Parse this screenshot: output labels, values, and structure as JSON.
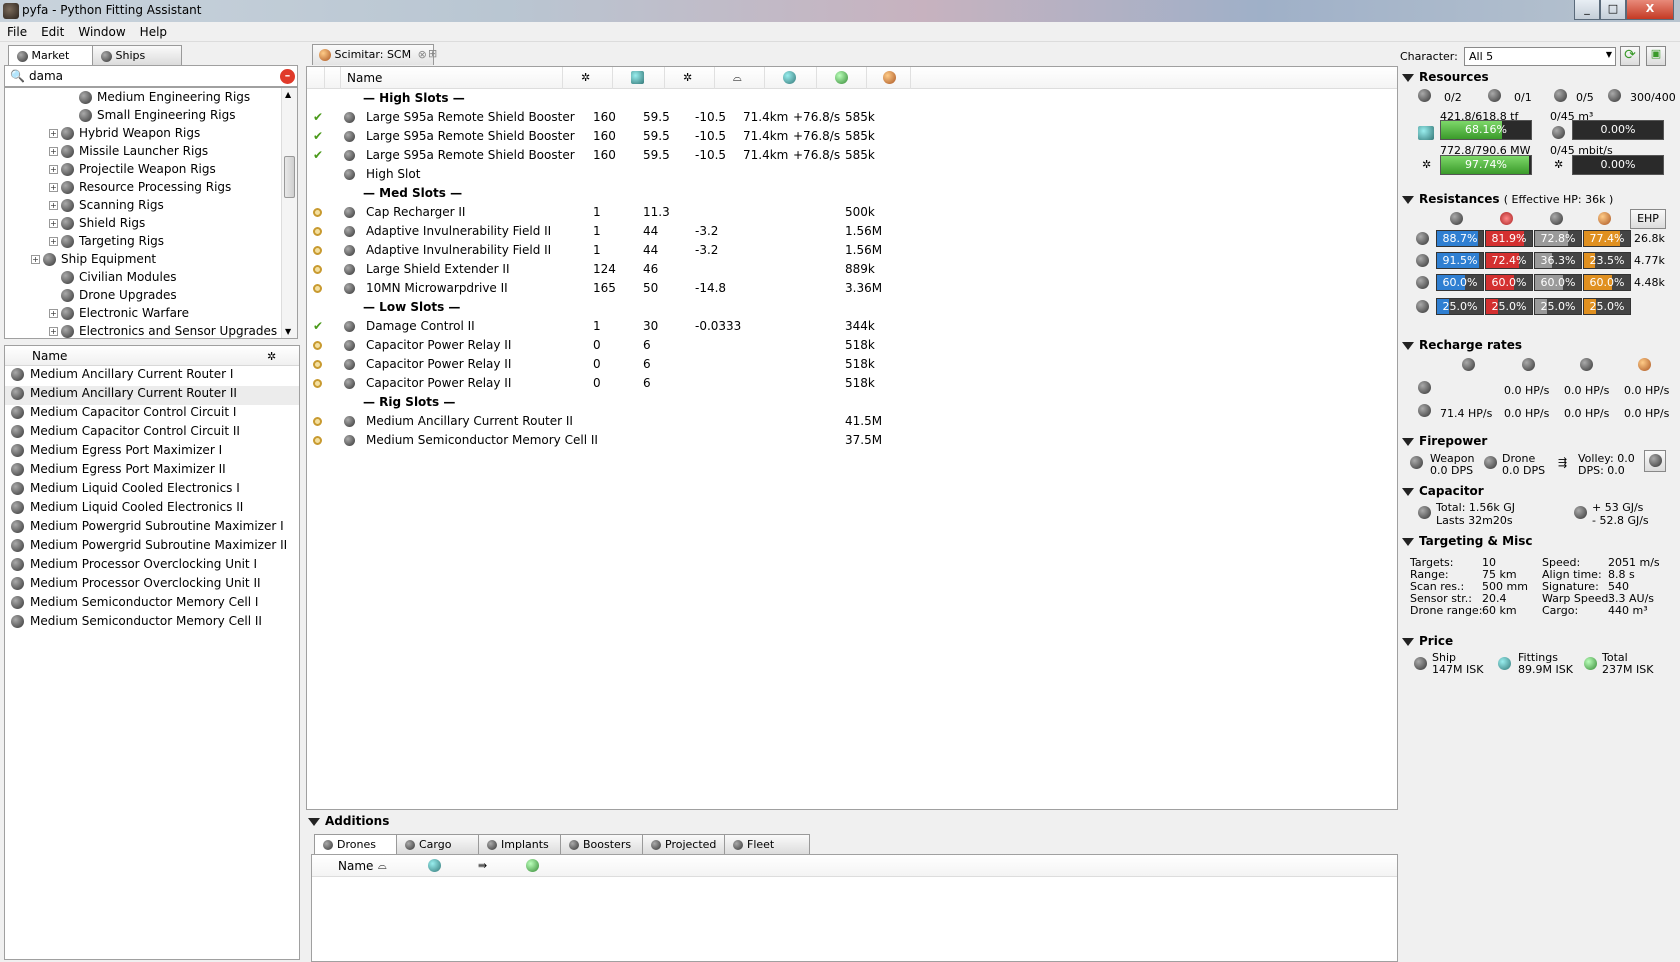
{
  "window": {
    "title": "pyfa - Python Fitting Assistant",
    "min": "_",
    "max": "□",
    "close": "X"
  },
  "menu": [
    "File",
    "Edit",
    "Window",
    "Help"
  ],
  "left": {
    "tabs": [
      "Market",
      "Ships"
    ],
    "search_value": "dama",
    "tree": [
      {
        "label": "Medium Engineering Rigs",
        "indent": 3,
        "exp": false
      },
      {
        "label": "Small Engineering Rigs",
        "indent": 3,
        "exp": false
      },
      {
        "label": "Hybrid Weapon Rigs",
        "indent": 2,
        "exp": true
      },
      {
        "label": "Missile Launcher Rigs",
        "indent": 2,
        "exp": true
      },
      {
        "label": "Projectile Weapon Rigs",
        "indent": 2,
        "exp": true
      },
      {
        "label": "Resource Processing Rigs",
        "indent": 2,
        "exp": true
      },
      {
        "label": "Scanning Rigs",
        "indent": 2,
        "exp": true
      },
      {
        "label": "Shield Rigs",
        "indent": 2,
        "exp": true
      },
      {
        "label": "Targeting Rigs",
        "indent": 2,
        "exp": true
      },
      {
        "label": "Ship Equipment",
        "indent": 1,
        "exp": true
      },
      {
        "label": "Civilian Modules",
        "indent": 2,
        "exp": false
      },
      {
        "label": "Drone Upgrades",
        "indent": 2,
        "exp": false
      },
      {
        "label": "Electronic Warfare",
        "indent": 2,
        "exp": true
      },
      {
        "label": "Electronics and Sensor Upgrades",
        "indent": 2,
        "exp": true
      }
    ],
    "list_header": "Name",
    "items": [
      "Medium Ancillary Current Router I",
      "Medium Ancillary Current Router II",
      "Medium Capacitor Control Circuit I",
      "Medium Capacitor Control Circuit II",
      "Medium Egress Port Maximizer I",
      "Medium Egress Port Maximizer II",
      "Medium Liquid Cooled Electronics I",
      "Medium Liquid Cooled Electronics II",
      "Medium Powergrid Subroutine Maximizer I",
      "Medium Powergrid Subroutine Maximizer II",
      "Medium Processor Overclocking Unit I",
      "Medium Processor Overclocking Unit II",
      "Medium Semiconductor Memory Cell I",
      "Medium Semiconductor Memory Cell II"
    ],
    "selected_index": 1
  },
  "fitting": {
    "tab_label": "Scimitar: SCM",
    "header_name": "Name",
    "rows": [
      {
        "type": "header",
        "name": "— High Slots —"
      },
      {
        "type": "mod",
        "state": "check",
        "name": "Large S95a Remote Shield Booster",
        "c1": "160",
        "c2": "59.5",
        "c3": "-10.5",
        "c4": "71.4km",
        "c5": "+76.8/s",
        "c6": "585k"
      },
      {
        "type": "mod",
        "state": "check",
        "name": "Large S95a Remote Shield Booster",
        "c1": "160",
        "c2": "59.5",
        "c3": "-10.5",
        "c4": "71.4km",
        "c5": "+76.8/s",
        "c6": "585k"
      },
      {
        "type": "mod",
        "state": "check",
        "name": "Large S95a Remote Shield Booster",
        "c1": "160",
        "c2": "59.5",
        "c3": "-10.5",
        "c4": "71.4km",
        "c5": "+76.8/s",
        "c6": "585k"
      },
      {
        "type": "mod",
        "state": "",
        "name": "High Slot",
        "c1": "",
        "c2": "",
        "c3": "",
        "c4": "",
        "c5": "",
        "c6": ""
      },
      {
        "type": "header",
        "name": "— Med Slots —"
      },
      {
        "type": "mod",
        "state": "dot",
        "name": "Cap Recharger II",
        "c1": "1",
        "c2": "11.3",
        "c3": "",
        "c4": "",
        "c5": "",
        "c6": "500k"
      },
      {
        "type": "mod",
        "state": "dot",
        "name": "Adaptive Invulnerability Field II",
        "c1": "1",
        "c2": "44",
        "c3": "-3.2",
        "c4": "",
        "c5": "",
        "c6": "1.56M"
      },
      {
        "type": "mod",
        "state": "dot",
        "name": "Adaptive Invulnerability Field II",
        "c1": "1",
        "c2": "44",
        "c3": "-3.2",
        "c4": "",
        "c5": "",
        "c6": "1.56M"
      },
      {
        "type": "mod",
        "state": "dot",
        "name": "Large Shield Extender II",
        "c1": "124",
        "c2": "46",
        "c3": "",
        "c4": "",
        "c5": "",
        "c6": "889k"
      },
      {
        "type": "mod",
        "state": "dot",
        "name": "10MN Microwarpdrive II",
        "c1": "165",
        "c2": "50",
        "c3": "-14.8",
        "c4": "",
        "c5": "",
        "c6": "3.36M"
      },
      {
        "type": "header",
        "name": "— Low Slots —"
      },
      {
        "type": "mod",
        "state": "check",
        "name": "Damage Control II",
        "c1": "1",
        "c2": "30",
        "c3": "-0.0333",
        "c4": "",
        "c5": "",
        "c6": "344k"
      },
      {
        "type": "mod",
        "state": "dot",
        "name": "Capacitor Power Relay II",
        "c1": "0",
        "c2": "6",
        "c3": "",
        "c4": "",
        "c5": "",
        "c6": "518k"
      },
      {
        "type": "mod",
        "state": "dot",
        "name": "Capacitor Power Relay II",
        "c1": "0",
        "c2": "6",
        "c3": "",
        "c4": "",
        "c5": "",
        "c6": "518k"
      },
      {
        "type": "mod",
        "state": "dot",
        "name": "Capacitor Power Relay II",
        "c1": "0",
        "c2": "6",
        "c3": "",
        "c4": "",
        "c5": "",
        "c6": "518k"
      },
      {
        "type": "header",
        "name": "— Rig Slots —"
      },
      {
        "type": "mod",
        "state": "dot",
        "name": "Medium Ancillary Current Router II",
        "c1": "",
        "c2": "",
        "c3": "",
        "c4": "",
        "c5": "",
        "c6": "41.5M"
      },
      {
        "type": "mod",
        "state": "dot",
        "name": "Medium Semiconductor Memory Cell II",
        "c1": "",
        "c2": "",
        "c3": "",
        "c4": "",
        "c5": "",
        "c6": "37.5M"
      }
    ]
  },
  "additions": {
    "title": "Additions",
    "tabs": [
      "Drones",
      "Cargo",
      "Implants",
      "Boosters",
      "Projected",
      "Fleet"
    ],
    "drone_header": "Name"
  },
  "right": {
    "character_label": "Character:",
    "character_value": "All 5",
    "resources": {
      "title": "Resources",
      "hardpoints": [
        "0/2",
        "0/1",
        "0/5",
        "300/400"
      ],
      "cpu_text": "421.8/618.8 tf",
      "cpu_pct": "68.16%",
      "cpu_frac": 0.6816,
      "drone_bay_text": "0/45 m³",
      "drone_bay_pct": "0.00%",
      "pg_text": "772.8/790.6 MW",
      "pg_pct": "97.74%",
      "pg_frac": 0.9774,
      "bandwidth_text": "0/45 mbit/s",
      "bandwidth_pct": "0.00%"
    },
    "resistances": {
      "title": "Resistances",
      "ehp_note": "( Effective HP: 36k )",
      "ehp_button": "EHP",
      "rows": [
        {
          "vals": [
            "88.7%",
            "81.9%",
            "72.8%",
            "77.4%"
          ],
          "fracs": [
            0.887,
            0.819,
            0.728,
            0.774
          ],
          "hp": "26.8k"
        },
        {
          "vals": [
            "91.5%",
            "72.4%",
            "36.3%",
            "23.5%"
          ],
          "fracs": [
            0.915,
            0.724,
            0.363,
            0.235
          ],
          "hp": "4.77k"
        },
        {
          "vals": [
            "60.0%",
            "60.0%",
            "60.0%",
            "60.0%"
          ],
          "fracs": [
            0.6,
            0.6,
            0.6,
            0.6
          ],
          "hp": "4.48k"
        },
        {
          "vals": [
            "25.0%",
            "25.0%",
            "25.0%",
            "25.0%"
          ],
          "fracs": [
            0.25,
            0.25,
            0.25,
            0.25
          ],
          "hp": ""
        }
      ],
      "colors": [
        "#2f7fd2",
        "#d43030",
        "#9a9a9a",
        "#e09020"
      ]
    },
    "recharge": {
      "title": "Recharge rates",
      "row1": [
        "",
        "0.0 HP/s",
        "0.0 HP/s",
        "0.0 HP/s"
      ],
      "row2": [
        "71.4 HP/s",
        "0.0 HP/s",
        "0.0 HP/s",
        "0.0 HP/s"
      ]
    },
    "firepower": {
      "title": "Firepower",
      "weapon_label": "Weapon",
      "weapon_dps": "0.0 DPS",
      "drone_label": "Drone",
      "drone_dps": "0.0 DPS",
      "volley": "Volley: 0.0",
      "dps": "DPS: 0.0"
    },
    "capacitor": {
      "title": "Capacitor",
      "total": "Total: 1.56k GJ",
      "lasts": "Lasts 32m20s",
      "plus": "+  53  GJ/s",
      "minus": "-  52.8 GJ/s"
    },
    "targeting": {
      "title": "Targeting & Misc",
      "left": [
        [
          "Targets:",
          "10"
        ],
        [
          "Range:",
          "75 km"
        ],
        [
          "Scan res.:",
          "500 mm"
        ],
        [
          "Sensor str.:",
          "20.4"
        ],
        [
          "Drone range:",
          "60 km"
        ]
      ],
      "right": [
        [
          "Speed:",
          "2051 m/s"
        ],
        [
          "Align time:",
          "8.8 s"
        ],
        [
          "Signature:",
          "540"
        ],
        [
          "Warp Speed:",
          "3.3 AU/s"
        ],
        [
          "Cargo:",
          "440 m³"
        ]
      ]
    },
    "price": {
      "title": "Price",
      "ship_label": "Ship",
      "ship_val": "147M ISK",
      "fit_label": "Fittings",
      "fit_val": "89.9M ISK",
      "total_label": "Total",
      "total_val": "237M ISK"
    }
  }
}
